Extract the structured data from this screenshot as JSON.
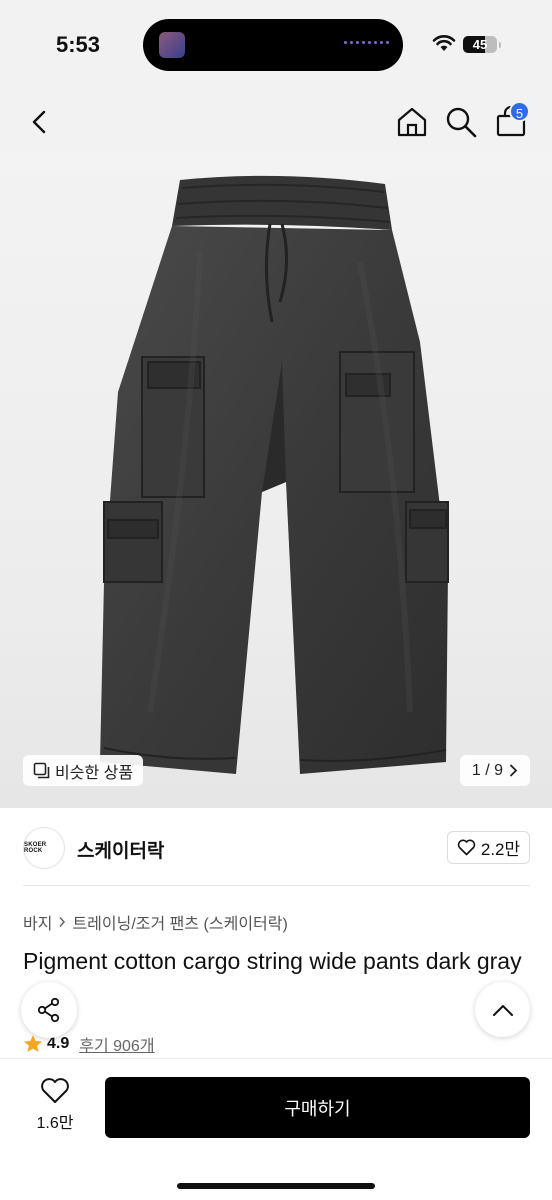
{
  "status": {
    "time": "5:53",
    "battery": "45"
  },
  "nav": {
    "cart_count": "5"
  },
  "gallery": {
    "similar_label": "비슷한 상품",
    "pager": "1 / 9"
  },
  "brand": {
    "logo_text": "SKOER ROCK",
    "name": "스케이터락",
    "likes": "2.2만"
  },
  "product": {
    "breadcrumb": [
      "바지",
      "트레이닝/조거 팬츠 (스케이터락)"
    ],
    "title": "Pigment cotton cargo string wide pants dark gray",
    "rating": "4.9",
    "reviews": "후기 906개"
  },
  "bottom": {
    "wish_count": "1.6만",
    "buy_label": "구매하기"
  },
  "colors": {
    "badge": "#2f6bf0",
    "star": "#f5a623",
    "buy_button": "#000000"
  },
  "icons": [
    "chevron-left-icon",
    "home-icon",
    "search-icon",
    "cart-icon",
    "similar-icon",
    "chevron-right-icon",
    "heart-icon",
    "share-icon",
    "chevron-up-icon",
    "star-icon"
  ]
}
